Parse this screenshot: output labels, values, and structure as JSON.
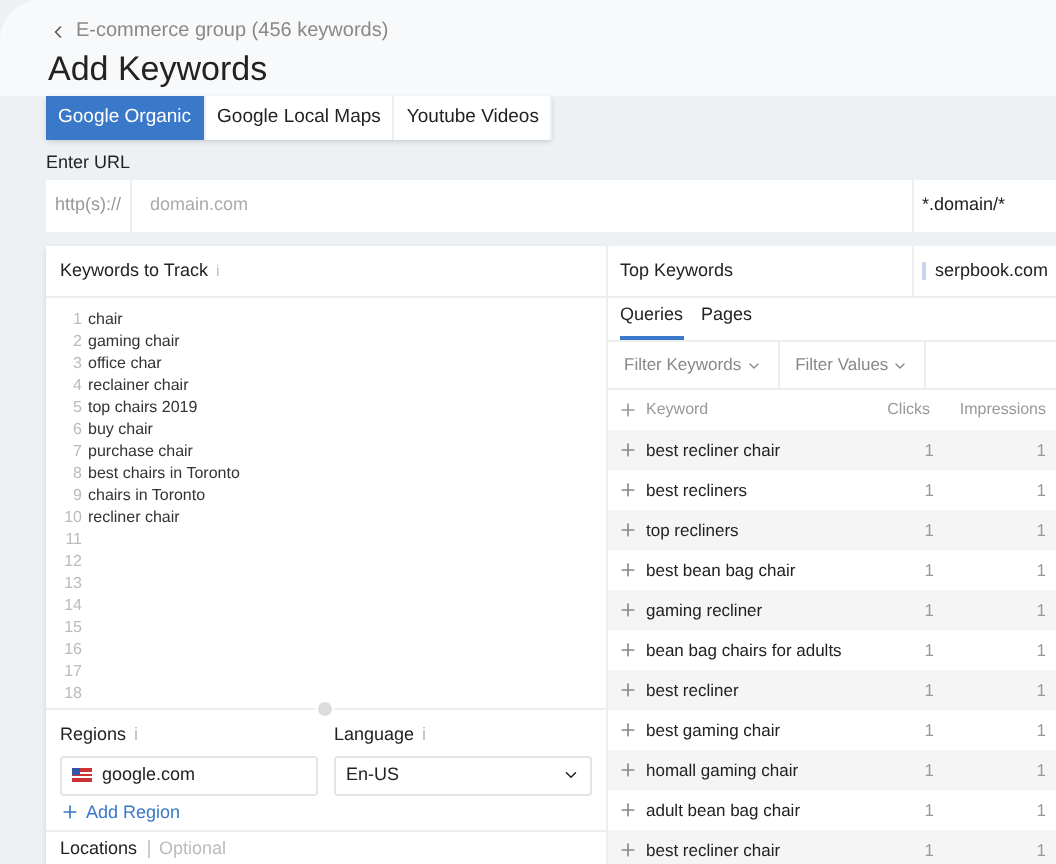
{
  "breadcrumb": "E-commerce group (456 keywords)",
  "title": "Add Keywords",
  "tabs": [
    {
      "label": "Google Organic",
      "selected": true
    },
    {
      "label": "Google Local Maps",
      "selected": false
    },
    {
      "label": "Youtube Videos",
      "selected": false
    }
  ],
  "url": {
    "label": "Enter URL",
    "prefix": "http(s)://",
    "placeholder": "domain.com",
    "scope": "*.domain/*"
  },
  "keywords_panel": {
    "title": "Keywords to Track",
    "info": "i",
    "lines": [
      {
        "number": "1",
        "text": "chair"
      },
      {
        "number": "2",
        "text": "gaming chair"
      },
      {
        "number": "3",
        "text": "office char"
      },
      {
        "number": "4",
        "text": "reclainer chair"
      },
      {
        "number": "5",
        "text": "top chairs 2019"
      },
      {
        "number": "6",
        "text": "buy chair"
      },
      {
        "number": "7",
        "text": "purchase chair"
      },
      {
        "number": "8",
        "text": "best chairs in Toronto"
      },
      {
        "number": "9",
        "text": "chairs in Toronto"
      },
      {
        "number": "10",
        "text": "recliner chair"
      },
      {
        "number": "11"
      },
      {
        "number": "12"
      },
      {
        "number": "13"
      },
      {
        "number": "14"
      },
      {
        "number": "15"
      },
      {
        "number": "16"
      },
      {
        "number": "17"
      },
      {
        "number": "18"
      }
    ]
  },
  "regions": {
    "label": "Regions",
    "info": "i",
    "value": "google.com",
    "add": "Add Region"
  },
  "language": {
    "label": "Language",
    "info": "i",
    "value": "En-US"
  },
  "locations": {
    "label": "Locations",
    "optional": "Optional"
  },
  "top_keywords": {
    "title": "Top Keywords",
    "site": "serpbook.com",
    "tabs": [
      {
        "label": "Queries",
        "selected": true
      },
      {
        "label": "Pages",
        "selected": false
      }
    ],
    "filters": [
      "Filter Keywords",
      "Filter Values"
    ],
    "columns": [
      "Keyword",
      "Clicks",
      "Impressions"
    ],
    "rows": [
      [
        "best recliner chair",
        "1",
        "1"
      ],
      [
        "best recliners",
        "1",
        "1"
      ],
      [
        "top recliners",
        "1",
        "1"
      ],
      [
        "best bean bag chair",
        "1",
        "1"
      ],
      [
        "gaming recliner",
        "1",
        "1"
      ],
      [
        "bean bag chairs for adults",
        "1",
        "1"
      ],
      [
        "best recliner",
        "1",
        "1"
      ],
      [
        "best gaming chair",
        "1",
        "1"
      ],
      [
        "homall gaming chair",
        "1",
        "1"
      ],
      [
        "adult bean bag chair",
        "1",
        "1"
      ],
      [
        "best recliner chair",
        "1",
        "1"
      ]
    ]
  }
}
